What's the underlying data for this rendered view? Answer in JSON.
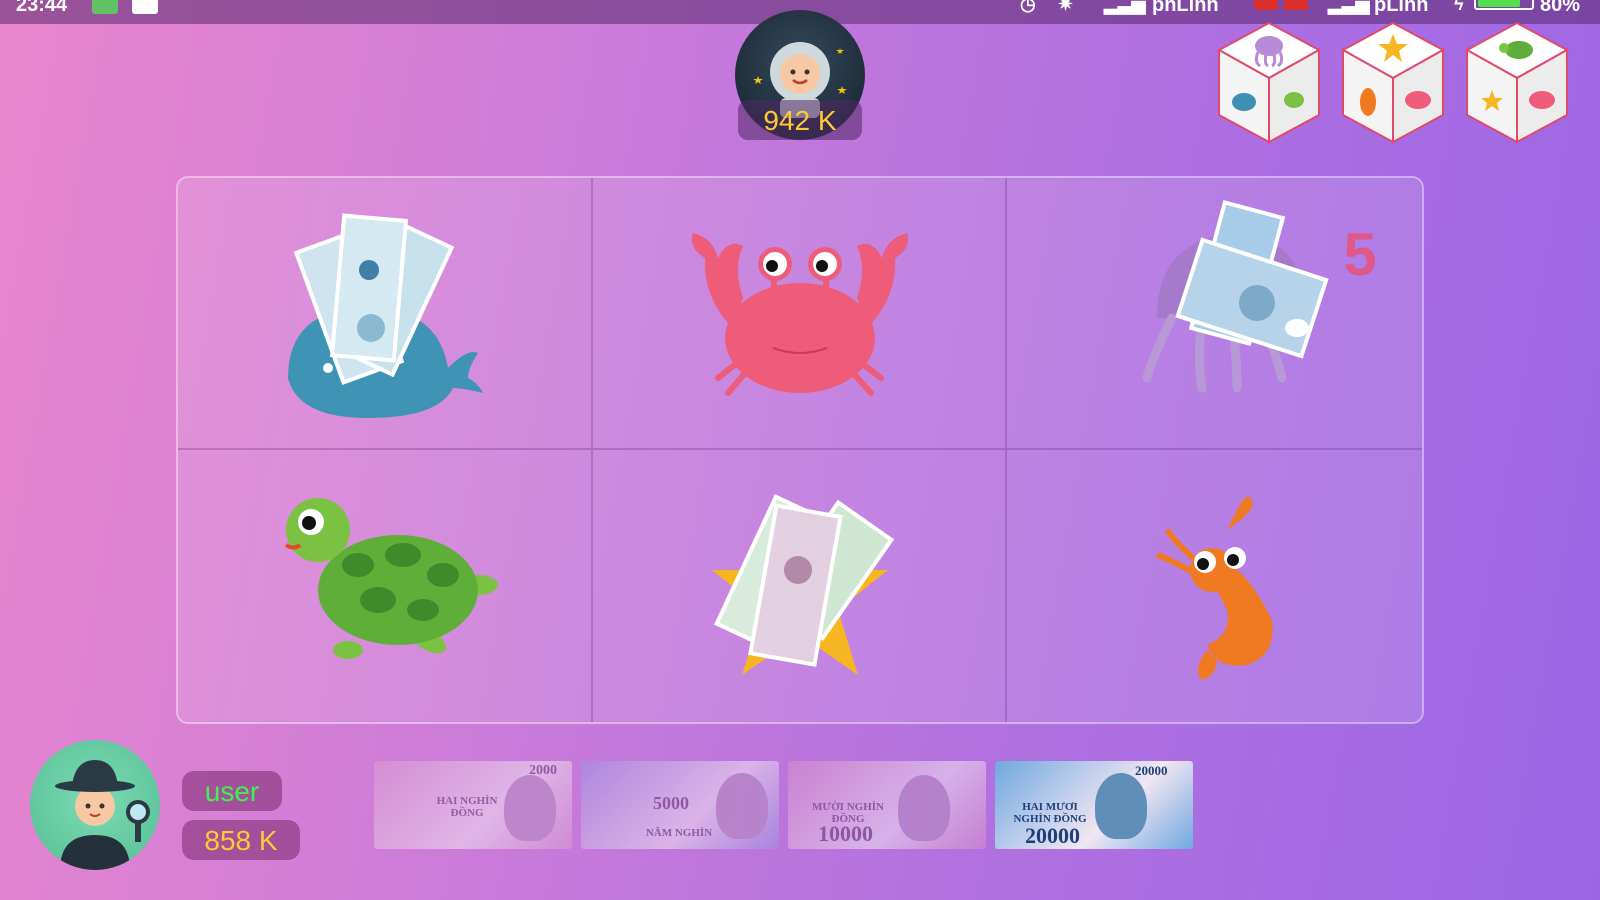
{
  "status_bar": {
    "time": "23:44",
    "carrier_1": "phLinh",
    "carrier_2": "pLinh",
    "battery": "80%",
    "battery_level": 0.8
  },
  "dealer": {
    "balance": "942 K"
  },
  "dice": [
    {
      "icon": "jellyfish-fish-turtle-die-icon"
    },
    {
      "icon": "starfish-shrimp-crab-die-icon"
    },
    {
      "icon": "turtle-starfish-crab-die-icon"
    }
  ],
  "board": {
    "cells": [
      {
        "animal": "whale",
        "has_bet": true
      },
      {
        "animal": "crab",
        "has_bet": false
      },
      {
        "animal": "jellyfish",
        "has_bet": true,
        "bet_count": "5"
      },
      {
        "animal": "turtle",
        "has_bet": false
      },
      {
        "animal": "starfish",
        "has_bet": true
      },
      {
        "animal": "shrimp",
        "has_bet": false
      }
    ]
  },
  "player": {
    "name": "user",
    "balance": "858 K"
  },
  "bills": [
    {
      "denomination": "2000",
      "words": "HAI NGHÌN ĐỒNG",
      "selected": false,
      "color": "#d99ad0"
    },
    {
      "denomination": "5000",
      "words": "NĂM NGHÌN",
      "selected": false,
      "color": "#9d8fe0"
    },
    {
      "denomination": "10000",
      "words": "MƯỜI NGHÌN ĐỒNG",
      "selected": false,
      "color": "#d78cc8"
    },
    {
      "denomination": "20000",
      "words": "HAI MƯƠI NGHÌN ĐỒNG",
      "selected": true,
      "color": "#6fa8e0"
    }
  ]
}
